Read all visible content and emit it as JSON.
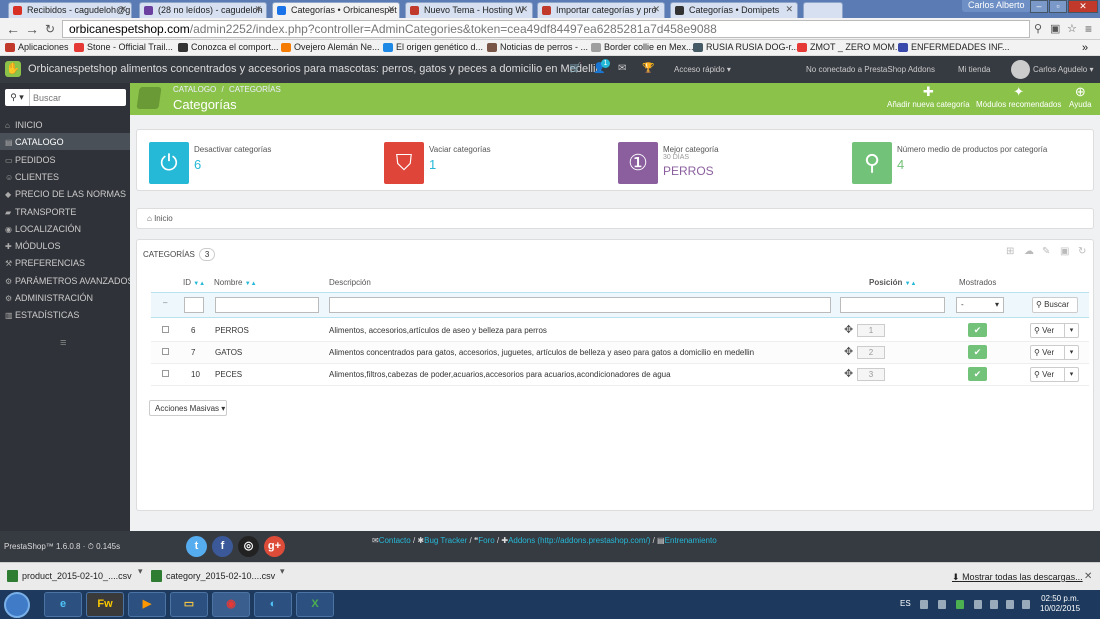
{
  "browser": {
    "tabs": [
      {
        "label": "Recibidos - cagudeloh@g",
        "color": "#d93025"
      },
      {
        "label": "(28 no leídos) - cagudeloh",
        "color": "#6b3fa0"
      },
      {
        "label": "Categorías • Orbicanespet",
        "color": "#1a73e8",
        "active": true
      },
      {
        "label": "Nuevo Tema - Hosting W",
        "color": "#c0392b"
      },
      {
        "label": "Importar categorías y pro",
        "color": "#c0392b"
      },
      {
        "label": "Categorías • Domipets",
        "color": "#333333"
      }
    ],
    "user": "Carlos Alberto",
    "url_host": "orbicanespetshop.com",
    "url_rest": "/admin2252/index.php?controller=AdminCategories&token=cea49df84497ea6285281a7d458e9088"
  },
  "bookmarks": [
    {
      "label": "Aplicaciones",
      "color": "#c0392b"
    },
    {
      "label": "Stone - Official Trail...",
      "color": "#e53935"
    },
    {
      "label": "Conozca el comport...",
      "color": "#333333"
    },
    {
      "label": "Ovejero Alemán Ne...",
      "color": "#f57c00"
    },
    {
      "label": "El origen genético d...",
      "color": "#1e88e5"
    },
    {
      "label": "Noticias de perros - ...",
      "color": "#795548"
    },
    {
      "label": "Border collie en Mex...",
      "color": "#9e9e9e"
    },
    {
      "label": "RUSIA RUSIA DOG-r...",
      "color": "#455a64"
    },
    {
      "label": "ZMOT _ ZERO MOM...",
      "color": "#e53935"
    },
    {
      "label": "ENFERMEDADES INF...",
      "color": "#3949ab"
    }
  ],
  "header": {
    "shop_name": "Orbicanespetshop alimentos concentrados y accesorios para mascotas: perros, gatos y peces a domicilio en Medellin",
    "notification_count": "1",
    "quick_access": "Acceso rápido ▾",
    "not_connected": "No conectado a PrestaShop Addons",
    "my_shop": "Mi tienda",
    "employee": "Carlos Agudelo ▾"
  },
  "sidebar": {
    "search_placeholder": "Buscar",
    "items": [
      {
        "label": "INICIO",
        "icon": "home-icon",
        "glyph": "⌂"
      },
      {
        "label": "CATALOGO",
        "icon": "book-icon",
        "glyph": "▤",
        "active": true
      },
      {
        "label": "PEDIDOS",
        "icon": "card-icon",
        "glyph": "▭"
      },
      {
        "label": "CLIENTES",
        "icon": "users-icon",
        "glyph": "☺"
      },
      {
        "label": "PRECIO DE LAS NORMAS",
        "icon": "tag-icon",
        "glyph": "◆"
      },
      {
        "label": "TRANSPORTE",
        "icon": "truck-icon",
        "glyph": "▰"
      },
      {
        "label": "LOCALIZACIÓN",
        "icon": "globe-icon",
        "glyph": "◉"
      },
      {
        "label": "MÓDULOS",
        "icon": "puzzle-icon",
        "glyph": "✚"
      },
      {
        "label": "PREFERENCIAS",
        "icon": "wrench-icon",
        "glyph": "⚒"
      },
      {
        "label": "PARÁMETROS AVANZADOS",
        "icon": "cogs-icon",
        "glyph": "⚙"
      },
      {
        "label": "ADMINISTRACIÓN",
        "icon": "gear-icon",
        "glyph": "⚙"
      },
      {
        "label": "ESTADÍSTICAS",
        "icon": "chart-icon",
        "glyph": "▥"
      }
    ]
  },
  "toolbar": {
    "breadcrumb": [
      "CATALOGO",
      "CATEGORÍAS"
    ],
    "title": "Categorías",
    "buttons": [
      {
        "label": "Añadir nueva categoría",
        "icon": "plus-icon",
        "glyph": "✚"
      },
      {
        "label": "Módulos recomendados",
        "icon": "puzzle-icon",
        "glyph": "✦"
      },
      {
        "label": "Ayuda",
        "icon": "help-icon",
        "glyph": "⊕"
      }
    ]
  },
  "kpis": [
    {
      "label": "Desactivar categorías",
      "value": "6",
      "color": "#25b9d7",
      "icon": "power-icon",
      "glyph": "⏻"
    },
    {
      "label": "Vaciar categorías",
      "value": "1",
      "color": "#e0453a",
      "icon": "bookmark-icon",
      "glyph": "⛉"
    },
    {
      "label": "Mejor categoría",
      "sub": "30 DÍAS",
      "value": "PERROS",
      "color": "#8b5f9e",
      "icon": "money-icon",
      "glyph": "①"
    },
    {
      "label": "Número medio de productos por categoría",
      "value": "4",
      "color": "#72c279",
      "icon": "search-icon",
      "glyph": "⚲"
    }
  ],
  "crumb": "Inicio",
  "table": {
    "title": "CATEGORÍAS",
    "count": "3",
    "columns": {
      "id": "ID",
      "name": "Nombre",
      "description": "Descripción",
      "position": "Posición",
      "shown": "Mostrados"
    },
    "filter_select": "-",
    "search_label": "Buscar",
    "rows": [
      {
        "id": "6",
        "name": "PERROS",
        "description": "Alimentos, accesorios,artículos de aseo y belleza para perros",
        "position": "1"
      },
      {
        "id": "7",
        "name": "GATOS",
        "description": "Alimentos concentrados para gatos, accesorios, juguetes, artículos de belleza y aseo para gatos a domicilio en medellin",
        "position": "2"
      },
      {
        "id": "10",
        "name": "PECES",
        "description": "Alimentos,filtros,cabezas de poder,acuarios,accesorios para acuarios,acondicionadores de agua",
        "position": "3"
      }
    ],
    "view_label": "Ver",
    "bulk_label": "Acciones Masivas ▾"
  },
  "footer": {
    "version": "PrestaShop™ 1.6.0.8 · ⏱ 0.145s",
    "links": [
      "Contacto",
      "Bug Tracker",
      "Foro",
      "Addons (http://addons.prestashop.com/)",
      "Entrenamiento"
    ]
  },
  "downloads": {
    "files": [
      "product_2015-02-10_....csv",
      "category_2015-02-10....csv"
    ],
    "show_all": "Mostrar todas las descargas..."
  },
  "taskbar": {
    "lang": "ES",
    "time": "02:50 p.m.",
    "date": "10/02/2015"
  }
}
